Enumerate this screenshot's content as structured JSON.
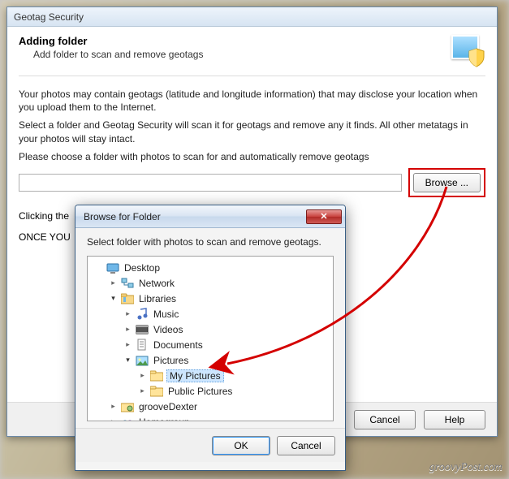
{
  "watermark": "groovyPost.com",
  "main": {
    "title": "Geotag Security",
    "heading": "Adding folder",
    "subheading": "Add folder to scan and remove geotags",
    "para1": "Your photos may contain geotags (latitude and longitude information) that may disclose your location when you upload them to the Internet.",
    "para2": "Select a folder and Geotag Security will scan it for geotags and remove any it finds. All other metatags in your photos will stay intact.",
    "choose_label": "Please choose a folder with photos to scan for and automatically remove geotags",
    "path_value": "",
    "browse_label": "Browse ...",
    "line1": "Clicking the",
    "line2": "ONCE YOU",
    "cancel_label": "Cancel",
    "help_label": "Help"
  },
  "dlg": {
    "title": "Browse for Folder",
    "instruction": "Select folder with photos to scan and remove geotags.",
    "ok_label": "OK",
    "cancel_label": "Cancel"
  },
  "tree": {
    "desktop": "Desktop",
    "network": "Network",
    "libraries": "Libraries",
    "music": "Music",
    "videos": "Videos",
    "documents": "Documents",
    "pictures": "Pictures",
    "my_pictures": "My Pictures",
    "public_pictures": "Public Pictures",
    "groovedexter": "grooveDexter",
    "homegroup": "Homegroup"
  }
}
